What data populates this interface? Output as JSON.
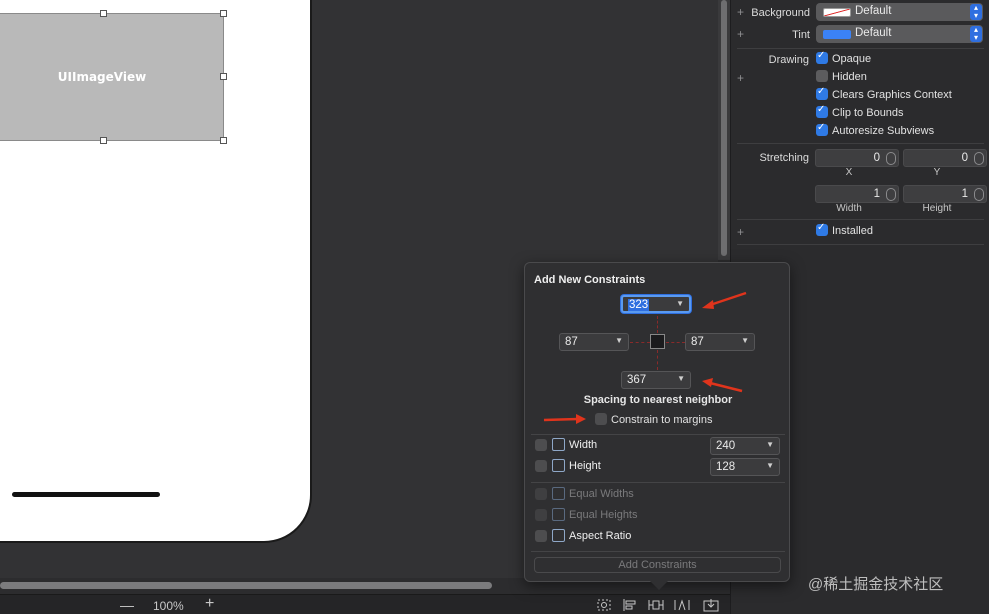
{
  "canvas": {
    "image_view_label": "UIImageView"
  },
  "bottom_bar": {
    "zoom_minus": "—",
    "zoom_level": "100%",
    "zoom_plus": "+"
  },
  "inspector": {
    "background": {
      "label": "Background",
      "value": "Default"
    },
    "tint": {
      "label": "Tint",
      "value": "Default",
      "color": "#3b82f6"
    },
    "drawing_label": "Drawing",
    "drawing_options": [
      {
        "label": "Opaque",
        "checked": true
      },
      {
        "label": "Hidden",
        "checked": false
      },
      {
        "label": "Clears Graphics Context",
        "checked": true
      },
      {
        "label": "Clip to Bounds",
        "checked": true
      },
      {
        "label": "Autoresize Subviews",
        "checked": true
      }
    ],
    "stretching": {
      "label": "Stretching",
      "x": {
        "value": "0",
        "label": "X"
      },
      "y": {
        "value": "0",
        "label": "Y"
      },
      "width": {
        "value": "1",
        "label": "Width"
      },
      "height": {
        "value": "1",
        "label": "Height"
      }
    },
    "installed": {
      "label": "Installed",
      "checked": true
    },
    "plus_glyph": "+"
  },
  "popover": {
    "title": "Add New Constraints",
    "top_value": "323",
    "left_value": "87",
    "right_value": "87",
    "bottom_value": "367",
    "spacing_label": "Spacing to nearest neighbor",
    "constrain_margins": {
      "label": "Constrain to margins",
      "checked": false
    },
    "constraints": [
      {
        "label": "Width",
        "value": "240",
        "enabled": true
      },
      {
        "label": "Height",
        "value": "128",
        "enabled": true
      }
    ],
    "equal_constraints": [
      {
        "label": "Equal Widths",
        "enabled": false
      },
      {
        "label": "Equal Heights",
        "enabled": false
      },
      {
        "label": "Aspect Ratio",
        "enabled": true
      }
    ],
    "add_button": "Add Constraints"
  },
  "watermark": "@稀土掘金技术社区",
  "colors": {
    "accent": "#2f7ae5",
    "annotation_arrow": "#e0341c"
  }
}
